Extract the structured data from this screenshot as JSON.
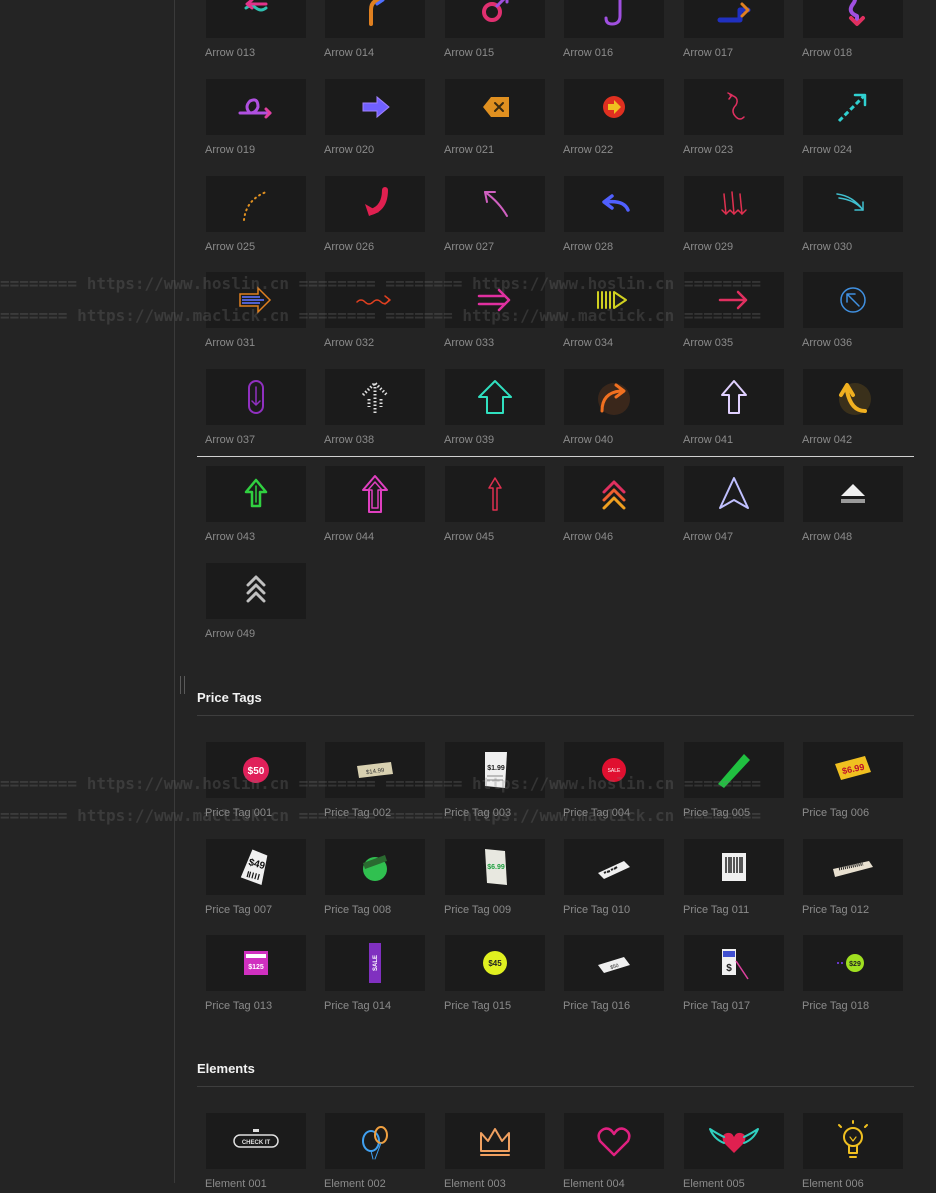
{
  "sections": {
    "price_tags_title": "Price Tags",
    "elements_title": "Elements"
  },
  "watermarks": [
    "======== https://www.hoslin.cn ======== ======== https://www.hoslin.cn ========",
    "======= https://www.maclick.cn ======== ======= https://www.maclick.cn ========"
  ],
  "arrows": [
    {
      "label": "Arrow 013",
      "icon": "wavy-arrow-left-icon",
      "color": "#e0338a",
      "color2": "#30c0b0"
    },
    {
      "label": "Arrow 014",
      "icon": "bent-arrow-up-right-icon",
      "color": "#e08020",
      "color2": "#5070ff"
    },
    {
      "label": "Arrow 015",
      "icon": "circle-arrow-icon",
      "color": "#e03070",
      "color2": "#a050e0"
    },
    {
      "label": "Arrow 016",
      "icon": "hook-arrow-icon",
      "color": "#a050e0",
      "color2": "#5060ff"
    },
    {
      "label": "Arrow 017",
      "icon": "step-arrow-up-right-icon",
      "color": "#2030c0",
      "color2": "#e08020"
    },
    {
      "label": "Arrow 018",
      "icon": "curly-arrow-down-icon",
      "color": "#a050e0",
      "color2": "#e03060"
    },
    {
      "label": "Arrow 019",
      "icon": "loop-arrow-right-icon",
      "color": "#b050e0",
      "color2": "#e040a0"
    },
    {
      "label": "Arrow 020",
      "icon": "block-arrow-right-icon",
      "color": "#7060ff",
      "color2": "#a080ff"
    },
    {
      "label": "Arrow 021",
      "icon": "tag-x-icon",
      "color": "#e09020",
      "color2": "#3a2a10"
    },
    {
      "label": "Arrow 022",
      "icon": "circle-play-arrow-icon",
      "color": "#e03020",
      "color2": "#f0c020"
    },
    {
      "label": "Arrow 023",
      "icon": "spiral-arrow-icon",
      "color": "#e03060",
      "color2": "#e03060"
    },
    {
      "label": "Arrow 024",
      "icon": "dashed-arrow-up-right-icon",
      "color": "#30d0d0",
      "color2": "#e04080"
    },
    {
      "label": "Arrow 025",
      "icon": "dotted-arrow-curve-icon",
      "color": "#e09020",
      "color2": "#e09020"
    },
    {
      "label": "Arrow 026",
      "icon": "thick-curved-arrow-down-icon",
      "color": "#e02050",
      "color2": "#e02050"
    },
    {
      "label": "Arrow 027",
      "icon": "thin-arrow-up-left-icon",
      "color": "#d060c0",
      "color2": "#d060c0"
    },
    {
      "label": "Arrow 028",
      "icon": "curved-arrow-left-icon",
      "color": "#5060ff",
      "color2": "#5060ff"
    },
    {
      "label": "Arrow 029",
      "icon": "triple-arrows-down-icon",
      "color": "#e03050",
      "color2": "#e03050"
    },
    {
      "label": "Arrow 030",
      "icon": "sketch-arrow-down-right-icon",
      "color": "#40c0d0",
      "color2": "#40c0d0"
    },
    {
      "label": "Arrow 031",
      "icon": "striped-arrow-right-icon",
      "color": "#5060d0",
      "color2": "#e08020"
    },
    {
      "label": "Arrow 032",
      "icon": "squiggle-arrow-right-icon",
      "color": "#e04020",
      "color2": "#e04020"
    },
    {
      "label": "Arrow 033",
      "icon": "double-arrow-right-icon",
      "color": "#e030a0",
      "color2": "#e030a0"
    },
    {
      "label": "Arrow 034",
      "icon": "lines-arrow-right-icon",
      "color": "#d0d020",
      "color2": "#d0d020"
    },
    {
      "label": "Arrow 035",
      "icon": "simple-arrow-right-icon",
      "color": "#e03060",
      "color2": "#e03060"
    },
    {
      "label": "Arrow 036",
      "icon": "circle-arrow-up-left-icon",
      "color": "#4090e0",
      "color2": "#4090e0"
    },
    {
      "label": "Arrow 037",
      "icon": "capsule-arrow-down-icon",
      "color": "#9030c0",
      "color2": "#9030c0"
    },
    {
      "label": "Arrow 038",
      "icon": "dotted-arrow-up-icon",
      "color": "#e0e0e0",
      "color2": "#e0e0e0"
    },
    {
      "label": "Arrow 039",
      "icon": "neon-outline-arrow-up-icon",
      "color": "#30e0c0",
      "color2": "#30e0c0"
    },
    {
      "label": "Arrow 040",
      "icon": "neon-curved-arrow-icon",
      "color": "#f07020",
      "color2": "#f07020"
    },
    {
      "label": "Arrow 041",
      "icon": "outline-arrow-up-icon",
      "color": "#e0d0ff",
      "color2": "#8060ff"
    },
    {
      "label": "Arrow 042",
      "icon": "glow-curved-arrow-up-icon",
      "color": "#f0b020",
      "color2": "#f0b020"
    },
    {
      "label": "Arrow 043",
      "icon": "green-outline-arrow-up-icon",
      "color": "#30d040",
      "color2": "#30d040"
    },
    {
      "label": "Arrow 044",
      "icon": "pink-double-arrow-up-icon",
      "color": "#e040c0",
      "color2": "#e040c0"
    },
    {
      "label": "Arrow 045",
      "icon": "red-thin-arrow-up-icon",
      "color": "#e03050",
      "color2": "#e03050"
    },
    {
      "label": "Arrow 046",
      "icon": "chevron-up-stack-icon",
      "color": "#e03060",
      "color2": "#f0a020"
    },
    {
      "label": "Arrow 047",
      "icon": "navigation-triangle-icon",
      "color": "#c0c0ff",
      "color2": "#6050ff"
    },
    {
      "label": "Arrow 048",
      "icon": "eject-arrow-icon",
      "color": "#f0f0f0",
      "color2": "#f0f0f0"
    },
    {
      "label": "Arrow 049",
      "icon": "triple-chevron-up-icon",
      "color": "#c0c0c0",
      "color2": "#c0c0c0"
    }
  ],
  "price_tags": [
    {
      "label": "Price Tag 001",
      "icon": "round-sticker-$50-icon",
      "color": "#e0205a",
      "text": "$50"
    },
    {
      "label": "Price Tag 002",
      "icon": "paper-tag-icon",
      "color": "#d8d0b0",
      "text": "$14.99"
    },
    {
      "label": "Price Tag 003",
      "icon": "receipt-tag-icon",
      "color": "#f0f0f0",
      "text": "$1.99"
    },
    {
      "label": "Price Tag 004",
      "icon": "red-circle-sale-icon",
      "color": "#e01030",
      "text": "SALE"
    },
    {
      "label": "Price Tag 005",
      "icon": "green-strip-tag-icon",
      "color": "#20c040",
      "text": ""
    },
    {
      "label": "Price Tag 006",
      "icon": "yellow-price-tag-icon",
      "color": "#f0c020",
      "text": "$6.99"
    },
    {
      "label": "Price Tag 007",
      "icon": "white-hang-tag-$49-icon",
      "color": "#f0f0f0",
      "text": "$49"
    },
    {
      "label": "Price Tag 008",
      "icon": "green-tag-icon",
      "color": "#30c050",
      "text": ""
    },
    {
      "label": "Price Tag 009",
      "icon": "ticket-tag-icon",
      "color": "#e8e8e0",
      "text": "$6.99"
    },
    {
      "label": "Price Tag 010",
      "icon": "barcode-tag-icon",
      "color": "#f0f0f0",
      "text": ""
    },
    {
      "label": "Price Tag 011",
      "icon": "barcode-label-icon",
      "color": "#f0f0f0",
      "text": ""
    },
    {
      "label": "Price Tag 012",
      "icon": "long-barcode-tag-icon",
      "color": "#e8e0d0",
      "text": ""
    },
    {
      "label": "Price Tag 013",
      "icon": "tshirt-price-icon",
      "color": "#d030c0",
      "text": "$125"
    },
    {
      "label": "Price Tag 014",
      "icon": "sale-banner-icon",
      "color": "#8030c0",
      "text": "SALE"
    },
    {
      "label": "Price Tag 015",
      "icon": "yellow-sticker-$45-icon",
      "color": "#e0f020",
      "text": "$45"
    },
    {
      "label": "Price Tag 016",
      "icon": "white-hang-tag-icon",
      "color": "#f0f0f0",
      "text": "$50"
    },
    {
      "label": "Price Tag 017",
      "icon": "dollar-sign-tag-icon",
      "color": "#f0f0f0",
      "text": "$"
    },
    {
      "label": "Price Tag 018",
      "icon": "green-sticker-$29-icon",
      "color": "#a0e020",
      "text": "$29"
    }
  ],
  "elements": [
    {
      "label": "Element 001",
      "icon": "check-it-badge-icon",
      "color": "#e0e0e0",
      "text": "CHECK IT"
    },
    {
      "label": "Element 002",
      "icon": "balloons-icon",
      "color": "#40a0f0",
      "text": ""
    },
    {
      "label": "Element 003",
      "icon": "crown-icon",
      "color": "#f0a060",
      "text": ""
    },
    {
      "label": "Element 004",
      "icon": "heart-outline-icon",
      "color": "#e02080",
      "text": ""
    },
    {
      "label": "Element 005",
      "icon": "winged-heart-icon",
      "color": "#e02050",
      "text": ""
    },
    {
      "label": "Element 006",
      "icon": "lightbulb-icon",
      "color": "#f0c020",
      "text": ""
    }
  ]
}
